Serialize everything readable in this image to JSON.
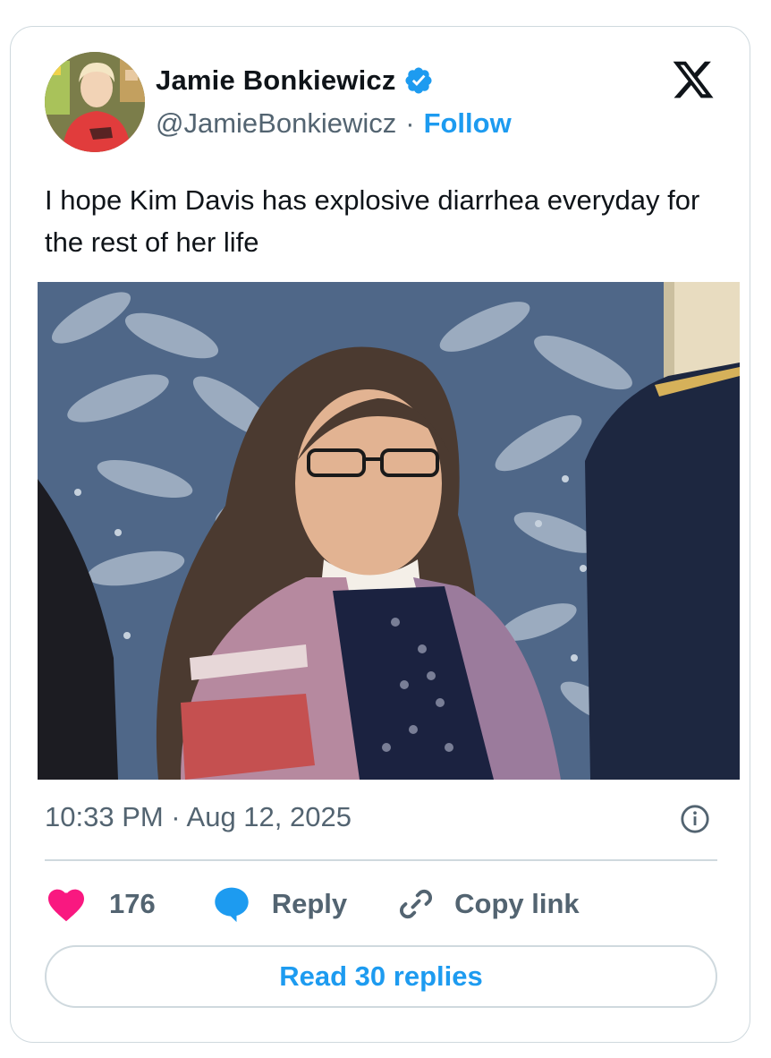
{
  "author": {
    "name": "Jamie Bonkiewicz",
    "handle": "@JamieBonkiewicz",
    "separator": "·",
    "follow_label": "Follow",
    "verified": true
  },
  "brand_icon": "x-logo-icon",
  "tweet": {
    "text": "I hope Kim Davis has explosive diarrhea everyday for the rest of her life",
    "timestamp": "10:33 PM · Aug 12, 2025"
  },
  "actions": {
    "like_count": "176",
    "reply_label": "Reply",
    "copy_link_label": "Copy link"
  },
  "read_replies_label": "Read 30 replies",
  "colors": {
    "accent": "#1d9bf0",
    "like": "#f91880",
    "muted": "#536471",
    "border": "#cfd9de"
  }
}
